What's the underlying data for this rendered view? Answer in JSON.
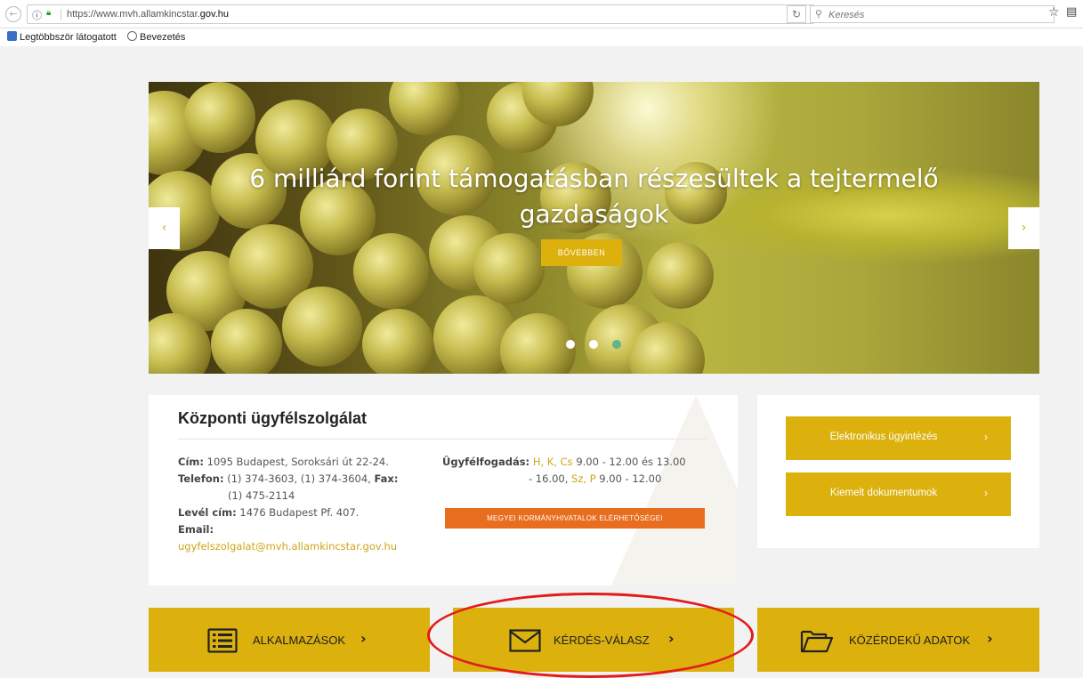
{
  "browser": {
    "url_prefix": "https://www.mvh.allamkincstar.",
    "url_domain": "gov.hu",
    "search_placeholder": "Keresés",
    "bookmarks": [
      "Legtöbbször látogatott",
      "Bevezetés"
    ]
  },
  "hero": {
    "title": "6 milliárd forint támogatásban részesültek a tejtermelő gazdaságok",
    "button": "BŐVEBBEN",
    "prev": "‹",
    "next": "›",
    "slide_count": 3,
    "active_slide": 3
  },
  "service": {
    "title": "Központi ügyfélszolgálat",
    "address_label": "Cím:",
    "address_value": "1095 Budapest, Soroksári út 22-24.",
    "phone_label": "Telefon:",
    "phone_value": "(1) 374-3603, (1) 374-3604,",
    "fax_label": "Fax:",
    "fax_value": "(1) 475-2114",
    "postal_label": "Levél cím:",
    "postal_value": "1476 Budapest Pf. 407.",
    "email_label": "Email:",
    "email_value": "ugyfelszolgalat@mvh.allamkincstar.gov.hu",
    "hours_label": "Ügyfélfogadás:",
    "hours_days1": "H, K, Cs",
    "hours_time1": "9.00 - 12.00 és 13.00",
    "hours_time1b": "- 16.00,",
    "hours_days2": "Sz, P",
    "hours_time2": "9.00 - 12.00",
    "county_button": "MEGYEI KORMÁNYHIVATALOK ELÉRHETŐSÉGEI"
  },
  "side": {
    "buttons": [
      "Elektronikus ügyintézés",
      "Kiemelt dokumentumok"
    ],
    "chevron": "›"
  },
  "tiles": [
    {
      "label": "ALKALMAZÁSOK",
      "icon": "list-icon"
    },
    {
      "label": "KÉRDÉS-VÁLASZ",
      "icon": "envelope-icon"
    },
    {
      "label": "KÖZÉRDEKŰ ADATOK",
      "icon": "folder-icon"
    }
  ],
  "tile_chevron": "›",
  "colors": {
    "accent": "#dcb10e",
    "orange": "#e86d1f",
    "highlight": "#e31b1b",
    "active_dot": "#5fb68c"
  }
}
